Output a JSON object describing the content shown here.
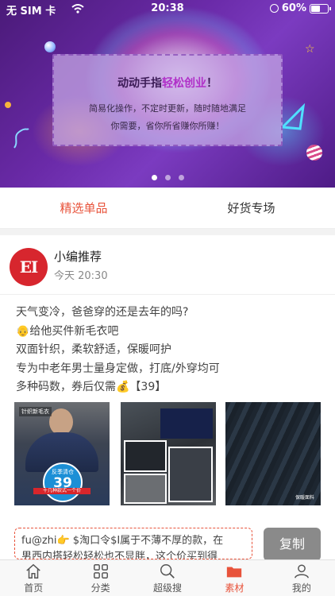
{
  "status_bar": {
    "carrier": "无 SIM 卡",
    "time": "20:38",
    "battery": "60%",
    "battery_level": 0.6
  },
  "banner": {
    "title_prefix": "动动手指",
    "title_accent": "轻松创业",
    "title_suffix": "！",
    "line1": "简易化操作，不定时更新，随时随地满足",
    "line2": "你需要，省你所省赚你所赚！",
    "page_count": 3,
    "active_index": 0,
    "accent_color": "#b02fc8"
  },
  "tabs": [
    {
      "label": "精选单品",
      "active": true
    },
    {
      "label": "好货专场",
      "active": false
    }
  ],
  "post": {
    "avatar_text": "EI",
    "author": "小编推荐",
    "time": "今天 20:30",
    "lines": [
      "天气变冷，爸爸穿的还是去年的吗?",
      "👴给他买件新毛衣吧",
      "双面针织，柔软舒适，保暖呵护",
      "专为中老年男士量身定做，打底/外穿均可",
      "多种码数，券后仅需💰【39】"
    ],
    "photos": [
      {
        "tag": "针织新毛衣",
        "badge_small": "反季清仓",
        "badge_price": "39",
        "strip": "十几种款式一个价",
        "icon": "product-photo-sweater-model"
      },
      {
        "icon": "product-photo-collage"
      },
      {
        "caption": "保暖面料",
        "icon": "product-photo-fabric-closeup"
      }
    ]
  },
  "copy_area": {
    "text_line1": "fu@zhi👉 $淘口令$I属于不薄不厚的款，在",
    "text_line2": "男西内搭轻松轻松也不显胖，这个价买到得",
    "button_label": "复制"
  },
  "tabbar": [
    {
      "label": "首页",
      "icon": "home-icon",
      "active": false
    },
    {
      "label": "分类",
      "icon": "grid-icon",
      "active": false
    },
    {
      "label": "超级搜",
      "icon": "search-icon",
      "active": false
    },
    {
      "label": "素材",
      "icon": "folder-icon",
      "active": true
    },
    {
      "label": "我的",
      "icon": "user-icon",
      "active": false
    }
  ],
  "colors": {
    "accent": "#e8533b",
    "banner_purple": "#6a2aa8",
    "avatar_red": "#d7262e"
  }
}
